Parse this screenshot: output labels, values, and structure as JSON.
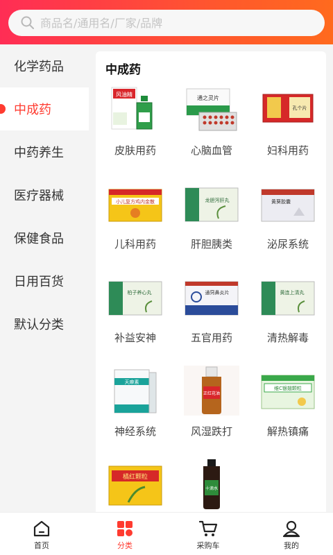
{
  "search": {
    "placeholder": "商品名/通用名/厂家/品牌"
  },
  "sidebar": {
    "items": [
      {
        "label": "化学药品"
      },
      {
        "label": "中成药"
      },
      {
        "label": "中药养生"
      },
      {
        "label": "医疗器械"
      },
      {
        "label": "保健食品"
      },
      {
        "label": "日用百货"
      },
      {
        "label": "默认分类"
      }
    ],
    "active_index": 1
  },
  "main": {
    "title": "中成药",
    "categories": [
      {
        "label": "皮肤用药",
        "box_text": "风油精"
      },
      {
        "label": "心脑血管",
        "box_text": "通之灵片"
      },
      {
        "label": "妇科用药",
        "box_text": "孔个片"
      },
      {
        "label": "儿科用药",
        "box_text": "小儿复方鸡内金散"
      },
      {
        "label": "肝胆胰类",
        "box_text": "龙胆泻肝丸"
      },
      {
        "label": "泌尿系统",
        "box_text": "黄葵胶囊"
      },
      {
        "label": "补益安神",
        "box_text": "柏子养心丸"
      },
      {
        "label": "五官用药",
        "box_text": "通窍鼻炎片"
      },
      {
        "label": "清热解毒",
        "box_text": "黄连上清丸"
      },
      {
        "label": "神经系统",
        "box_text": "天麻素"
      },
      {
        "label": "风湿跌打",
        "box_text": "正红花油"
      },
      {
        "label": "解热镇痛",
        "box_text": "维C银翘颗粒"
      },
      {
        "label": "",
        "box_text": "橘红颗粒"
      },
      {
        "label": "",
        "box_text": "十滴水"
      }
    ]
  },
  "bottom_nav": {
    "items": [
      {
        "label": "首页",
        "icon": "home-icon"
      },
      {
        "label": "分类",
        "icon": "category-icon"
      },
      {
        "label": "采购车",
        "icon": "cart-icon"
      },
      {
        "label": "我的",
        "icon": "user-icon"
      }
    ],
    "active_index": 1
  },
  "colors": {
    "accent": "#ff3b30",
    "header_start": "#ff2d55",
    "header_end": "#ff6a1e"
  }
}
